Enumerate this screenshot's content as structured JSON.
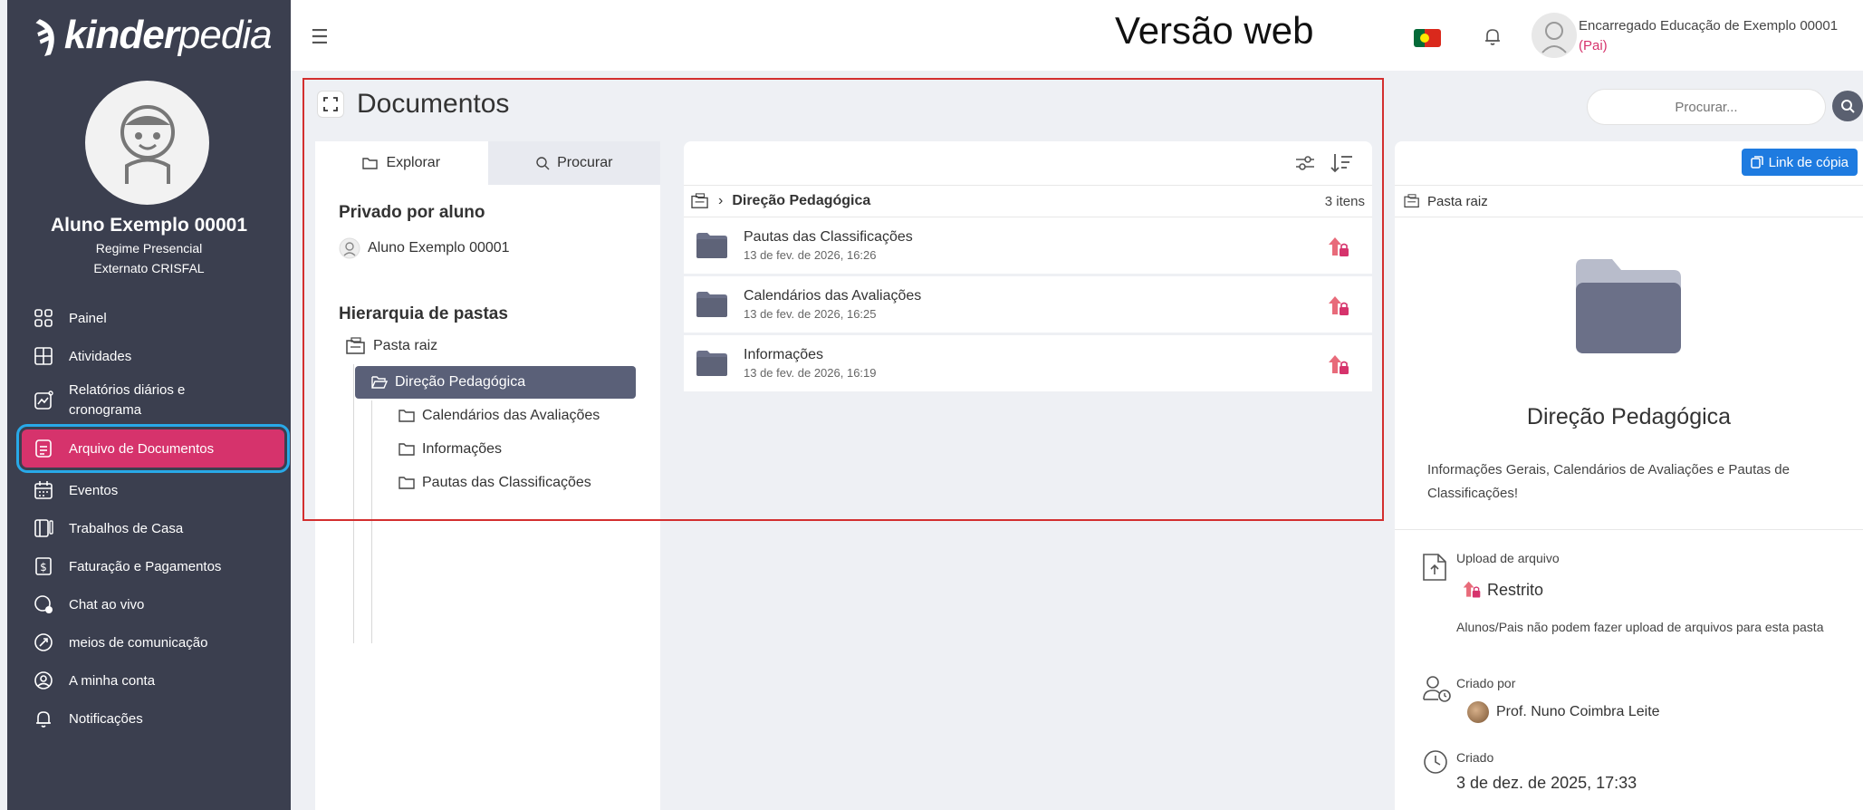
{
  "sidebar": {
    "logo_bold": "kinder",
    "logo_light": "pedia",
    "student_name": "Aluno Exemplo 00001",
    "student_line1": "Regime Presencial",
    "student_line2": "Externato CRISFAL",
    "items": [
      {
        "label": "Painel",
        "icon": "grid-icon"
      },
      {
        "label": "Atividades",
        "icon": "layout-icon"
      },
      {
        "label": "Relatórios diários e cronograma",
        "icon": "chart-icon"
      },
      {
        "label": "Arquivo de Documentos",
        "icon": "document-icon"
      },
      {
        "label": "Eventos",
        "icon": "calendar-icon"
      },
      {
        "label": "Trabalhos de Casa",
        "icon": "homework-icon"
      },
      {
        "label": "Faturação e Pagamentos",
        "icon": "invoice-icon"
      },
      {
        "label": "Chat ao vivo",
        "icon": "chat-icon"
      },
      {
        "label": "meios de comunicação",
        "icon": "media-icon"
      },
      {
        "label": "A minha conta",
        "icon": "account-icon"
      },
      {
        "label": "Notificações",
        "icon": "bell-icon"
      }
    ]
  },
  "topbar": {
    "web_label": "Versão web",
    "user_name": "Encarregado Educação de Exemplo 00001",
    "user_role": "(Pai)"
  },
  "main": {
    "title": "Documentos",
    "search_placeholder": "Procurar..."
  },
  "left_panel": {
    "tab_explore": "Explorar",
    "tab_search": "Procurar",
    "private_title": "Privado por aluno",
    "private_student": "Aluno Exemplo 00001",
    "hierarchy_title": "Hierarquia de pastas",
    "root": "Pasta raiz",
    "selected": "Direção Pedagógica",
    "children": [
      "Calendários das Avaliações",
      "Informações",
      "Pautas das Classificações"
    ]
  },
  "mid_panel": {
    "crumb": "Direção Pedagógica",
    "count": "3 itens",
    "files": [
      {
        "name": "Pautas das Classificações",
        "date": "13 de fev. de 2026, 16:26"
      },
      {
        "name": "Calendários das Avaliações",
        "date": "13 de fev. de 2026, 16:25"
      },
      {
        "name": "Informações",
        "date": "13 de fev. de 2026, 16:19"
      }
    ]
  },
  "right_panel": {
    "copy_link": "Link de cópia",
    "crumb": "Pasta raiz",
    "title": "Direção Pedagógica",
    "description": "Informações Gerais, Calendários de Avaliações e Pautas de Classificações!",
    "upload_label": "Upload de arquivo",
    "upload_status": "Restrito",
    "upload_note": "Alunos/Pais não podem fazer upload de arquivos para esta pasta",
    "created_by_label": "Criado por",
    "created_by": "Prof. Nuno Coimbra Leite",
    "created_label": "Criado",
    "created": "3 de dez. de 2025, 17:33"
  },
  "colors": {
    "sidebar": "#3b3f4f",
    "accent": "#d6336c",
    "highlight": "#28a9e8",
    "folder": "#6b7088",
    "link_button": "#1e7be0",
    "annotation": "#d32f2f"
  }
}
